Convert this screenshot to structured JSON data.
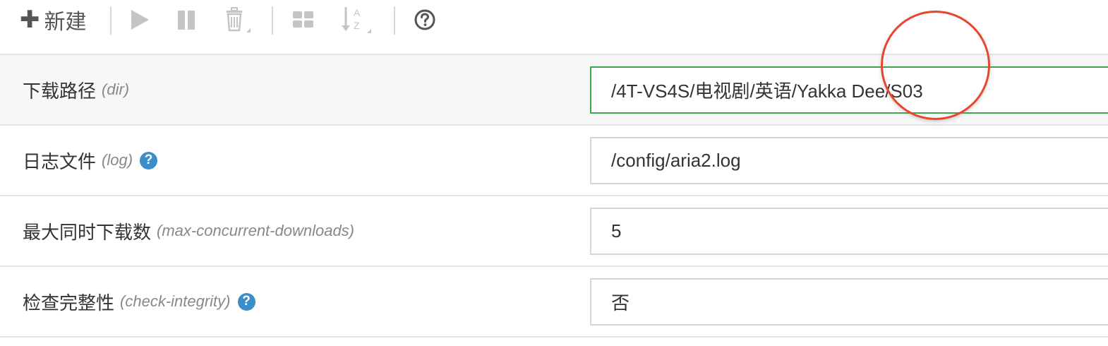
{
  "toolbar": {
    "new_label": "新建",
    "icons": [
      "plus-icon",
      "play-icon",
      "pause-icon",
      "trash-icon",
      "grid-icon",
      "sort-az-icon",
      "help-circle-icon"
    ],
    "az_top": "A",
    "az_bottom": "Z"
  },
  "settings": {
    "rows": [
      {
        "label": "下载路径",
        "option": "(dir)",
        "has_help": false,
        "value": "/4T-VS4S/电视剧/英语/Yakka Dee/S03",
        "focused": true
      },
      {
        "label": "日志文件",
        "option": "(log)",
        "has_help": true,
        "value": "/config/aria2.log",
        "focused": false
      },
      {
        "label": "最大同时下载数",
        "option": "(max-concurrent-downloads)",
        "has_help": false,
        "value": "5",
        "focused": false
      },
      {
        "label": "检查完整性",
        "option": "(check-integrity)",
        "has_help": true,
        "value": "否",
        "focused": false
      }
    ],
    "help_glyph": "?"
  },
  "colors": {
    "focus_border": "#3aa84f",
    "help_icon_bg": "#3a8fc8",
    "cursor_ring": "#e8462a",
    "toolbar_icon": "#c4c4c4"
  }
}
